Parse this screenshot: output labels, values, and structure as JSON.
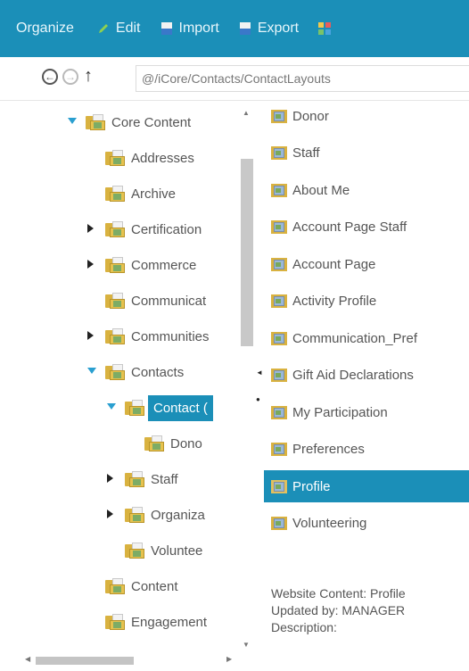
{
  "toolbar": {
    "organize": "Organize",
    "edit": "Edit",
    "import": "Import",
    "export": "Export"
  },
  "address": {
    "path": "@/iCore/Contacts/ContactLayouts"
  },
  "tree": {
    "items": [
      {
        "label": "Core Content",
        "caret": "open"
      },
      {
        "label": "Addresses",
        "caret": ""
      },
      {
        "label": "Archive",
        "caret": ""
      },
      {
        "label": "Certification",
        "caret": "closed"
      },
      {
        "label": "Commerce",
        "caret": "closed"
      },
      {
        "label": "Communicat",
        "caret": ""
      },
      {
        "label": "Communities",
        "caret": "closed"
      },
      {
        "label": "Contacts",
        "caret": "open"
      },
      {
        "label": "Contact (",
        "caret": "open"
      },
      {
        "label": "Dono",
        "caret": ""
      },
      {
        "label": "Staff",
        "caret": "closed"
      },
      {
        "label": "Organiza",
        "caret": "closed"
      },
      {
        "label": "Voluntee",
        "caret": ""
      },
      {
        "label": "Content",
        "caret": ""
      },
      {
        "label": "Engagement",
        "caret": ""
      }
    ]
  },
  "list": {
    "items": [
      {
        "label": "Donor"
      },
      {
        "label": "Staff"
      },
      {
        "label": "About Me"
      },
      {
        "label": "Account Page Staff"
      },
      {
        "label": "Account Page"
      },
      {
        "label": "Activity Profile"
      },
      {
        "label": "Communication_Pref"
      },
      {
        "label": "Gift Aid Declarations"
      },
      {
        "label": "My Participation"
      },
      {
        "label": "Preferences"
      },
      {
        "label": "Profile"
      },
      {
        "label": "Volunteering"
      }
    ]
  },
  "info": {
    "line1": "Website Content: Profile",
    "line2": "Updated by: MANAGER",
    "line3": "Description:"
  },
  "colors": {
    "accent": "#1b8fb8",
    "folder": "#d9b240"
  }
}
